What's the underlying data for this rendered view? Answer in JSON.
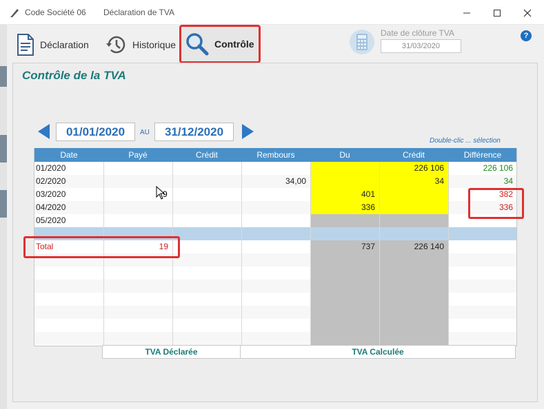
{
  "window": {
    "app_title": "Code Société 06",
    "doc_title": "Déclaration de TVA",
    "min_icon": "minimize-icon",
    "max_icon": "maximize-icon",
    "close_icon": "close-icon"
  },
  "toolbar": {
    "declaration_label": "Déclaration",
    "historique_label": "Historique",
    "controle_label": "Contrôle",
    "close_date_label": "Date de clôture TVA",
    "close_date_value": "31/03/2020",
    "help_label": "?"
  },
  "panel": {
    "title": "Contrôle de la TVA",
    "date_from": "01/01/2020",
    "date_to": "31/12/2020",
    "au_label": "AU",
    "double_click_hint": "Double-clic ... sélection"
  },
  "table": {
    "headers": [
      "Date",
      "Payé",
      "Crédit",
      "Rembours",
      "Du",
      "Crédit",
      "Différence"
    ],
    "rows": [
      {
        "date": "01/2020",
        "paye": "",
        "credit": "",
        "rembours": "",
        "du": "",
        "credit2": "226 106",
        "diff": "226 106",
        "diff_color": "#1a8a1a"
      },
      {
        "date": "02/2020",
        "paye": "",
        "credit": "",
        "rembours": "34,00",
        "du": "",
        "credit2": "34",
        "diff": "34",
        "diff_color": "#1a8a1a"
      },
      {
        "date": "03/2020",
        "paye": "",
        "credit": "",
        "rembours": "",
        "du": "401",
        "credit2": "",
        "diff": "382",
        "diff_color": "#cc2020"
      },
      {
        "date": "04/2020",
        "paye": "",
        "credit": "",
        "rembours": "",
        "du": "336",
        "credit2": "",
        "diff": "336",
        "diff_color": "#cc2020"
      },
      {
        "date": "05/2020",
        "paye": "",
        "credit": "",
        "rembours": "",
        "du": "",
        "credit2": "",
        "diff": "",
        "diff_color": "#222222"
      }
    ],
    "total": {
      "label": "Total",
      "paye": "19",
      "du": "737",
      "credit2": "226 140"
    },
    "partial_text": "9",
    "footer_declaree": "TVA Déclarée",
    "footer_calculee": "TVA Calculée"
  },
  "colors": {
    "accent_teal": "#1d7a7a",
    "header_blue": "#4a90c8",
    "highlight_red": "#e03030",
    "cell_yellow": "#ffff00"
  }
}
